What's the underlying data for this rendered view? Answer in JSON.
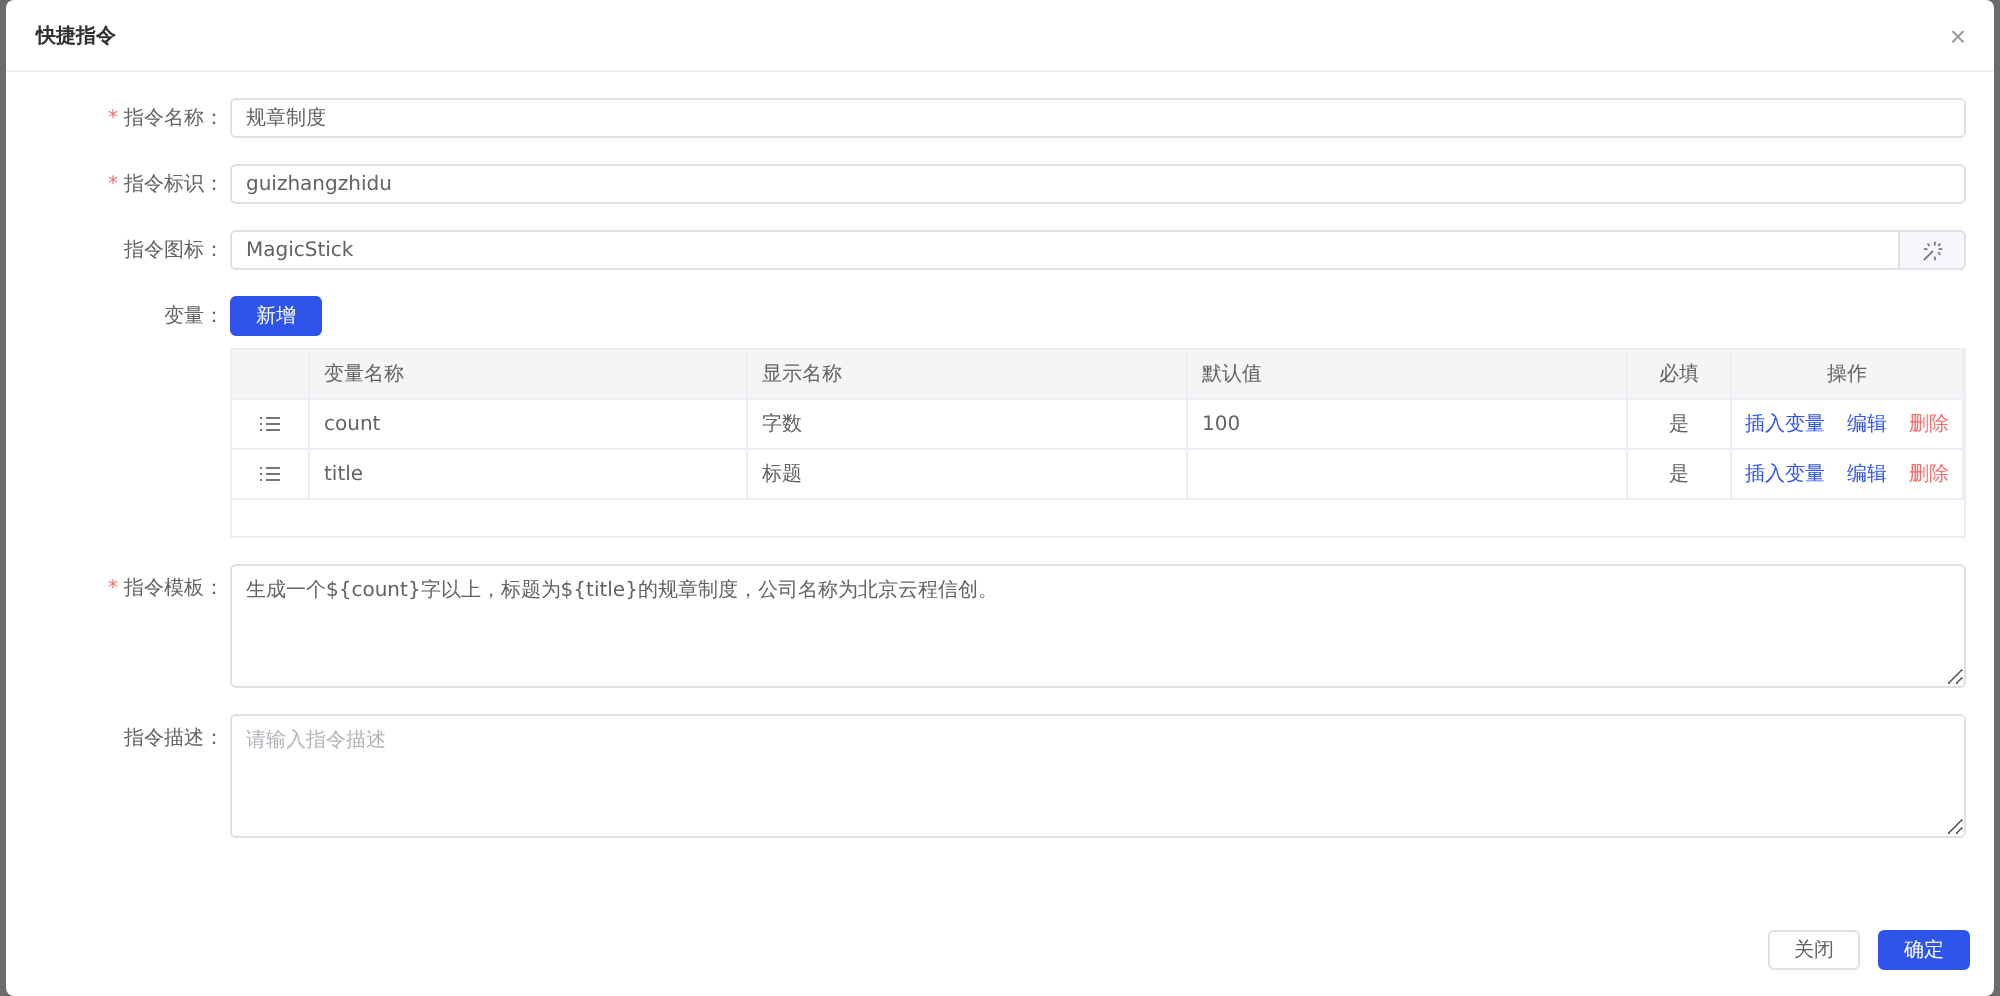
{
  "dialog": {
    "title": "快捷指令",
    "close": "×"
  },
  "fields": [
    {
      "kind": "input",
      "label": "指令名称：",
      "required_mark": "*",
      "value": "规章制度"
    },
    {
      "kind": "input",
      "label": "指令标识：",
      "required_mark": "*",
      "value": "guizhangzhidu"
    },
    {
      "kind": "icon-input",
      "label": "指令图标：",
      "value": "MagicStick"
    }
  ],
  "variables": {
    "label": "变量：",
    "add_button": "新增",
    "columns": [
      "变量名称",
      "显示名称",
      "默认值",
      "必填",
      "操作"
    ],
    "rows": [
      {
        "name": "count",
        "display": "字数",
        "default": "100",
        "required": "是",
        "actions": [
          "插入变量",
          "编辑",
          "删除"
        ]
      },
      {
        "name": "title",
        "display": "标题",
        "default": "",
        "required": "是",
        "actions": [
          "插入变量",
          "编辑",
          "删除"
        ]
      }
    ]
  },
  "textareas": [
    {
      "label": "指令模板：",
      "required_mark": "*",
      "value": "生成一个${count}字以上，标题为${title}的规章制度，公司名称为北京云程信创。"
    },
    {
      "label": "指令描述：",
      "placeholder": "请输入指令描述"
    }
  ],
  "buttons": [
    {
      "label": "关闭",
      "primary": false
    },
    {
      "label": "确定",
      "primary": true
    }
  ]
}
